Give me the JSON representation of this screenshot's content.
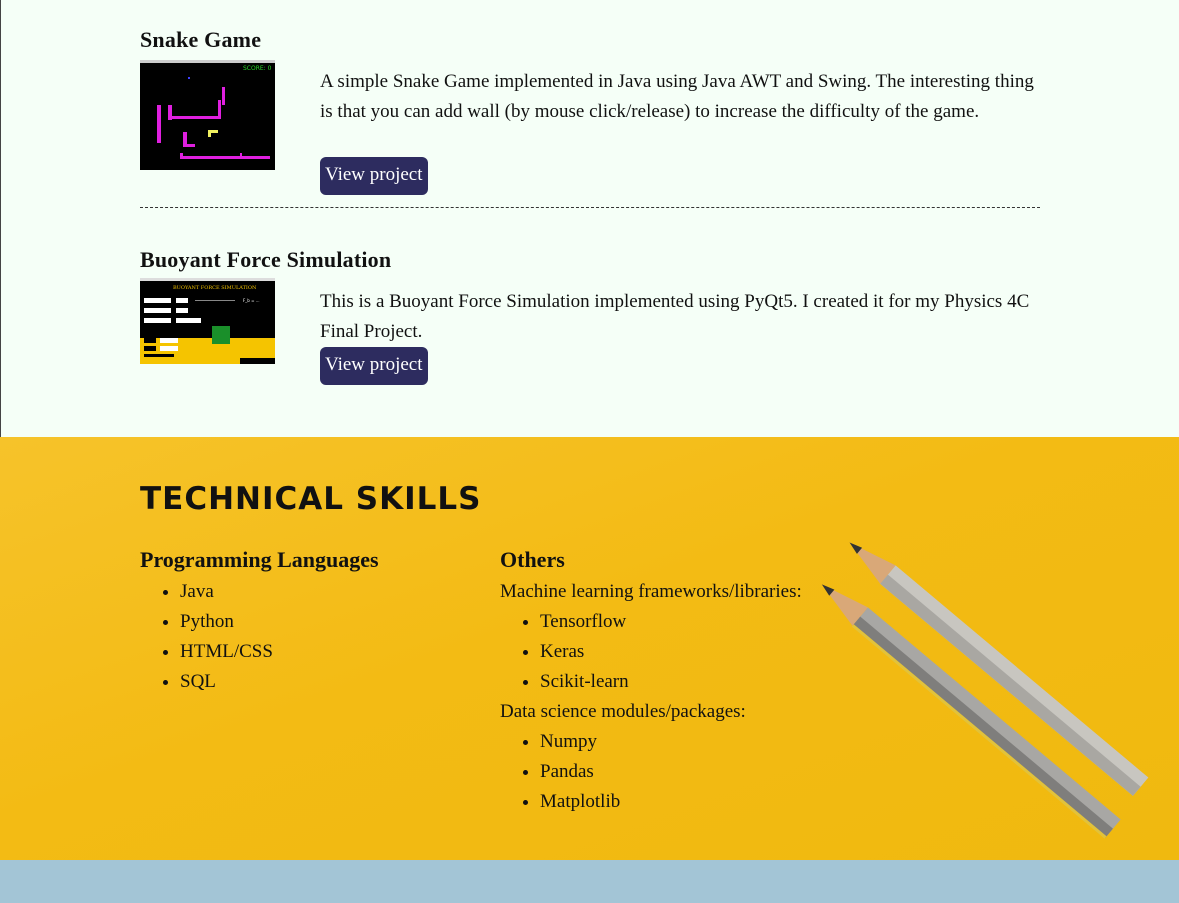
{
  "projects": [
    {
      "title": "Snake Game",
      "description": "A simple Snake Game implemented in Java using Java AWT and Swing. The interesting thing is that you can add wall (by mouse click/release) to increase the difficulty of the game.",
      "button_label": "View project",
      "thumbnail": {
        "score_text": "SCORE: 0",
        "colors": {
          "bg": "#000000",
          "wall": "#e020e0",
          "snake": "#f0f060"
        }
      }
    },
    {
      "title": "Buoyant Force Simulation",
      "description": "This is a Buoyant Force Simulation implemented using PyQt5. I created it for my Physics 4C Final Project.",
      "button_label": "View project",
      "thumbnail": {
        "header_text": "BUOYANT FORCE SIMULATION",
        "colors": {
          "bg": "#000000",
          "water": "#f5c400",
          "block": "#1a8f2a"
        }
      }
    }
  ],
  "skills": {
    "heading": "TECHNICAL SKILLS",
    "programming": {
      "heading": "Programming Languages",
      "items": [
        "Java",
        "Python",
        "HTML/CSS",
        "SQL"
      ]
    },
    "others": {
      "heading": "Others",
      "ml_label": "Machine learning frameworks/libraries:",
      "ml_items": [
        "Tensorflow",
        "Keras",
        "Scikit-learn"
      ],
      "ds_label": "Data science modules/packages:",
      "ds_items": [
        "Numpy",
        "Pandas",
        "Matplotlib"
      ]
    }
  },
  "colors": {
    "page_bg": "#f5fff7",
    "button_bg": "#2d2c5f",
    "skills_bg": "#f3bb14",
    "footer_bg": "#a3c5d6"
  }
}
